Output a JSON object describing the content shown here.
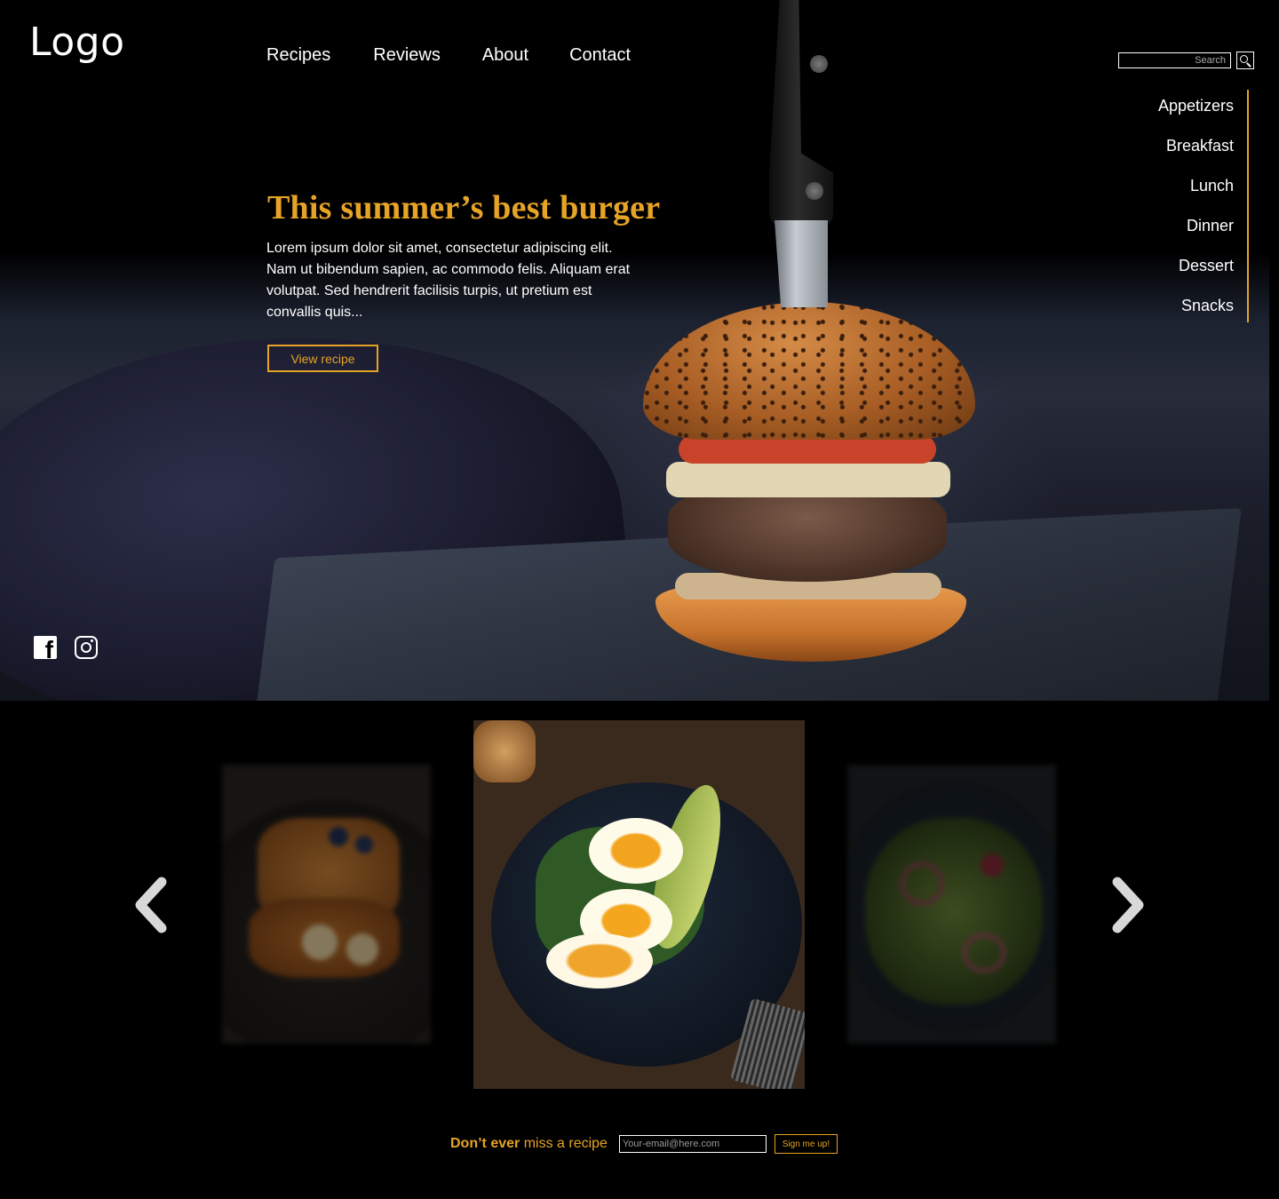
{
  "header": {
    "logo": "Logo",
    "nav": [
      "Recipes",
      "Reviews",
      "About",
      "Contact"
    ],
    "search": {
      "placeholder": "Search"
    }
  },
  "categories": [
    "Appetizers",
    "Breakfast",
    "Lunch",
    "Dinner",
    "Dessert",
    "Snacks"
  ],
  "feature": {
    "title": "This summer’s best burger",
    "description": "Lorem ipsum dolor sit amet, consectetur adipiscing elit. Nam ut bibendum sapien, ac commodo felis. Aliquam erat volutpat. Sed hendrerit facilisis turpis, ut pretium est convallis quis...",
    "button": "View recipe"
  },
  "social": [
    "facebook-icon",
    "instagram-icon"
  ],
  "carousel": {
    "items": [
      "french-toast",
      "egg-avocado-toast",
      "salad"
    ],
    "prev_icon": "chevron-left-icon",
    "next_icon": "chevron-right-icon"
  },
  "newsletter": {
    "text_bold": "Don’t ever",
    "text_rest": " miss a recipe",
    "email_placeholder": "Your-email@here.com",
    "button": "Sign me up!"
  },
  "colors": {
    "accent": "#e6a326",
    "background": "#000000",
    "text": "#ffffff"
  }
}
